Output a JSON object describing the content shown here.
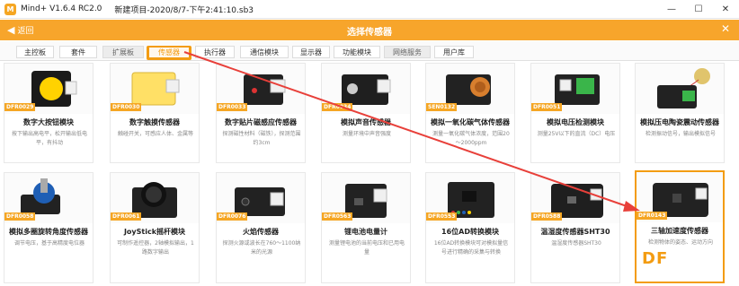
{
  "window": {
    "app_name": "Mind+ V1.6.4 RC2.0",
    "project": "新建项目-2020/8/7-下午2:41:10.sb3",
    "minimize": "—",
    "maximize": "☐",
    "close": "✕"
  },
  "header": {
    "back_label": "返回",
    "back_icon": "◀",
    "title": "选择传感器",
    "close_icon": "✕"
  },
  "tabs": [
    {
      "label": "主控板"
    },
    {
      "label": "套件"
    },
    {
      "label": "扩展板"
    },
    {
      "label": "传感器"
    },
    {
      "label": "执行器"
    },
    {
      "label": "通信模块"
    },
    {
      "label": "显示器"
    },
    {
      "label": "功能模块"
    },
    {
      "label": "网络服务"
    },
    {
      "label": "用户库"
    }
  ],
  "cards": [
    {
      "id": "DFR0029",
      "title": "数字大按钮模块",
      "desc": "按下输出高电平，松开输出低电平，有抖动"
    },
    {
      "id": "DFR0030",
      "title": "数字触摸传感器",
      "desc": "触碰开关，可感应人体、金属等"
    },
    {
      "id": "DFR0033",
      "title": "数字贴片磁感应传感器",
      "desc": "探测磁性材料（磁铁），探测范围约3cm"
    },
    {
      "id": "DFR0034",
      "title": "模拟声音传感器",
      "desc": "测量环境中声音强度"
    },
    {
      "id": "SEN0132",
      "title": "模拟一氧化碳气体传感器",
      "desc": "测量一氧化碳气体浓度，范围20～2000ppm"
    },
    {
      "id": "DFR0051",
      "title": "模拟电压检测模块",
      "desc": "测量25V以下的直流（DC）电压"
    },
    {
      "id": "",
      "title": "模拟压电陶瓷震动传感器",
      "desc": "检测振动信号，输出模拟信号"
    },
    {
      "id": "DFR0058",
      "title": "模拟多圈旋转角度传感器",
      "desc": "调节电压，基于高精度电位器"
    },
    {
      "id": "DFR0061",
      "title": "JoyStick摇杆模块",
      "desc": "可制作遥控器，2轴模拟输出，1路数字输出"
    },
    {
      "id": "DFR0076",
      "title": "火焰传感器",
      "desc": "探测火源或波长在760～1100纳米的光源"
    },
    {
      "id": "DFR0563",
      "title": "锂电池电量计",
      "desc": "测量锂电池的当前电压和已用电量"
    },
    {
      "id": "DFR0553",
      "title": "16位AD转换模块",
      "desc": "16位AD转换模块可对模拟量信号进行精确的采集与转换"
    },
    {
      "id": "DFR0588",
      "title": "温湿度传感器SHT30",
      "desc": "温湿度传感器SHT30"
    },
    {
      "id": "DFR0143",
      "title": "三轴加速度传感器",
      "desc": "检测物体的姿态、运动方向"
    }
  ],
  "watermark": "DF",
  "colors": {
    "accent": "#f39c12",
    "header": "#f7a52b",
    "arrow": "#e8403a"
  }
}
